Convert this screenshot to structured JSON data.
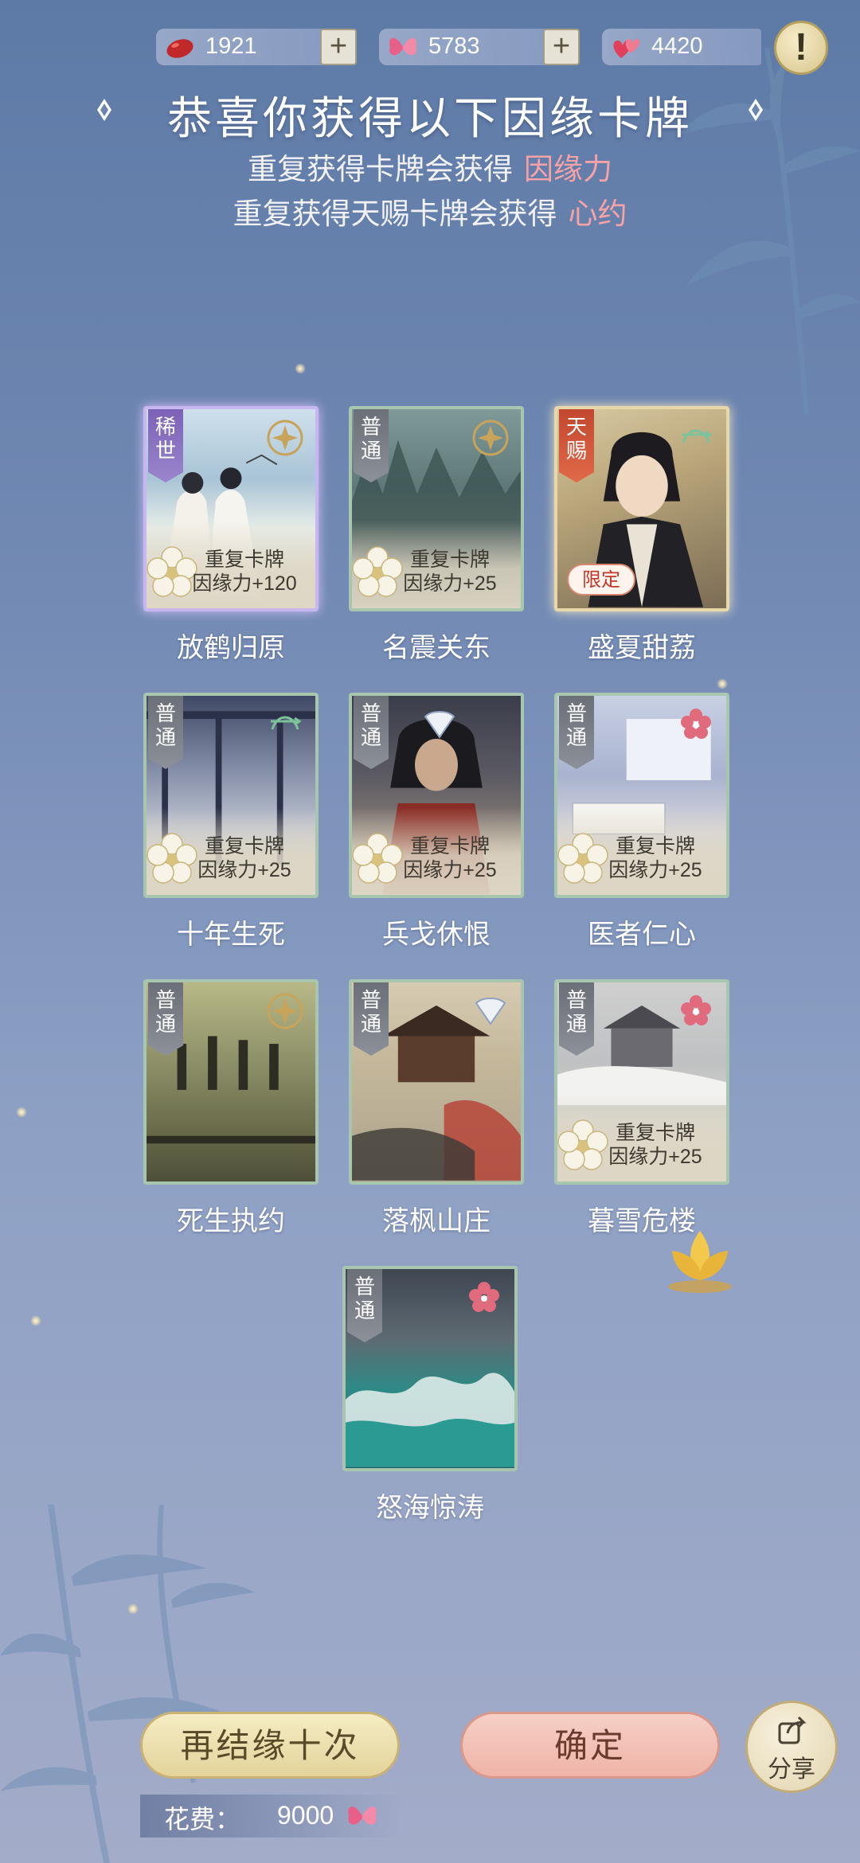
{
  "currencies": [
    {
      "icon": "red-bean-icon",
      "value": "1921",
      "has_plus": true
    },
    {
      "icon": "butterfly-icon",
      "value": "5783",
      "has_plus": true
    },
    {
      "icon": "hearts-icon",
      "value": "4420",
      "has_plus": false
    }
  ],
  "alert_label": "!",
  "header": {
    "title": "恭喜你获得以下因缘卡牌",
    "line1_text": "重复获得卡牌会获得",
    "line1_highlight": "因缘力",
    "line2_text": "重复获得天赐卡牌会获得",
    "line2_highlight": "心约"
  },
  "cards": [
    {
      "name": "放鹤归原",
      "tag": "稀世",
      "rarity": "rare",
      "dup_line1": "重复卡牌",
      "dup_line2": "因缘力+120",
      "emblem": "gold-coin-icon"
    },
    {
      "name": "名震关东",
      "tag": "普通",
      "rarity": "common",
      "dup_line1": "重复卡牌",
      "dup_line2": "因缘力+25",
      "emblem": "gold-coin-icon"
    },
    {
      "name": "盛夏甜荔",
      "tag": "天赐",
      "rarity": "gift",
      "limited": "限定",
      "emblem": "green-bow-icon"
    },
    {
      "name": "十年生死",
      "tag": "普通",
      "rarity": "common",
      "dup_line1": "重复卡牌",
      "dup_line2": "因缘力+25",
      "emblem": "green-bow-icon"
    },
    {
      "name": "兵戈休恨",
      "tag": "普通",
      "rarity": "common",
      "dup_line1": "重复卡牌",
      "dup_line2": "因缘力+25",
      "emblem": "fan-icon"
    },
    {
      "name": "医者仁心",
      "tag": "普通",
      "rarity": "common",
      "dup_line1": "重复卡牌",
      "dup_line2": "因缘力+25",
      "emblem": "red-flower-icon"
    },
    {
      "name": "死生执约",
      "tag": "普通",
      "rarity": "common",
      "emblem": "gold-coin-icon"
    },
    {
      "name": "落枫山庄",
      "tag": "普通",
      "rarity": "common",
      "emblem": "fan-icon"
    },
    {
      "name": "暮雪危楼",
      "tag": "普通",
      "rarity": "common",
      "dup_line1": "重复卡牌",
      "dup_line2": "因缘力+25",
      "emblem": "red-flower-icon"
    },
    {
      "name": "怒海惊涛",
      "tag": "普通",
      "rarity": "common",
      "emblem": "red-flower-icon"
    }
  ],
  "buttons": {
    "again": "再结缘十次",
    "confirm": "确定",
    "share": "分享"
  },
  "cost": {
    "label": "花费：",
    "value": "9000",
    "icon": "butterfly-icon"
  },
  "colors": {
    "highlight": "#f7a2a6",
    "bg_top": "#5d7aa6",
    "bg_bottom": "#a3acc9"
  }
}
